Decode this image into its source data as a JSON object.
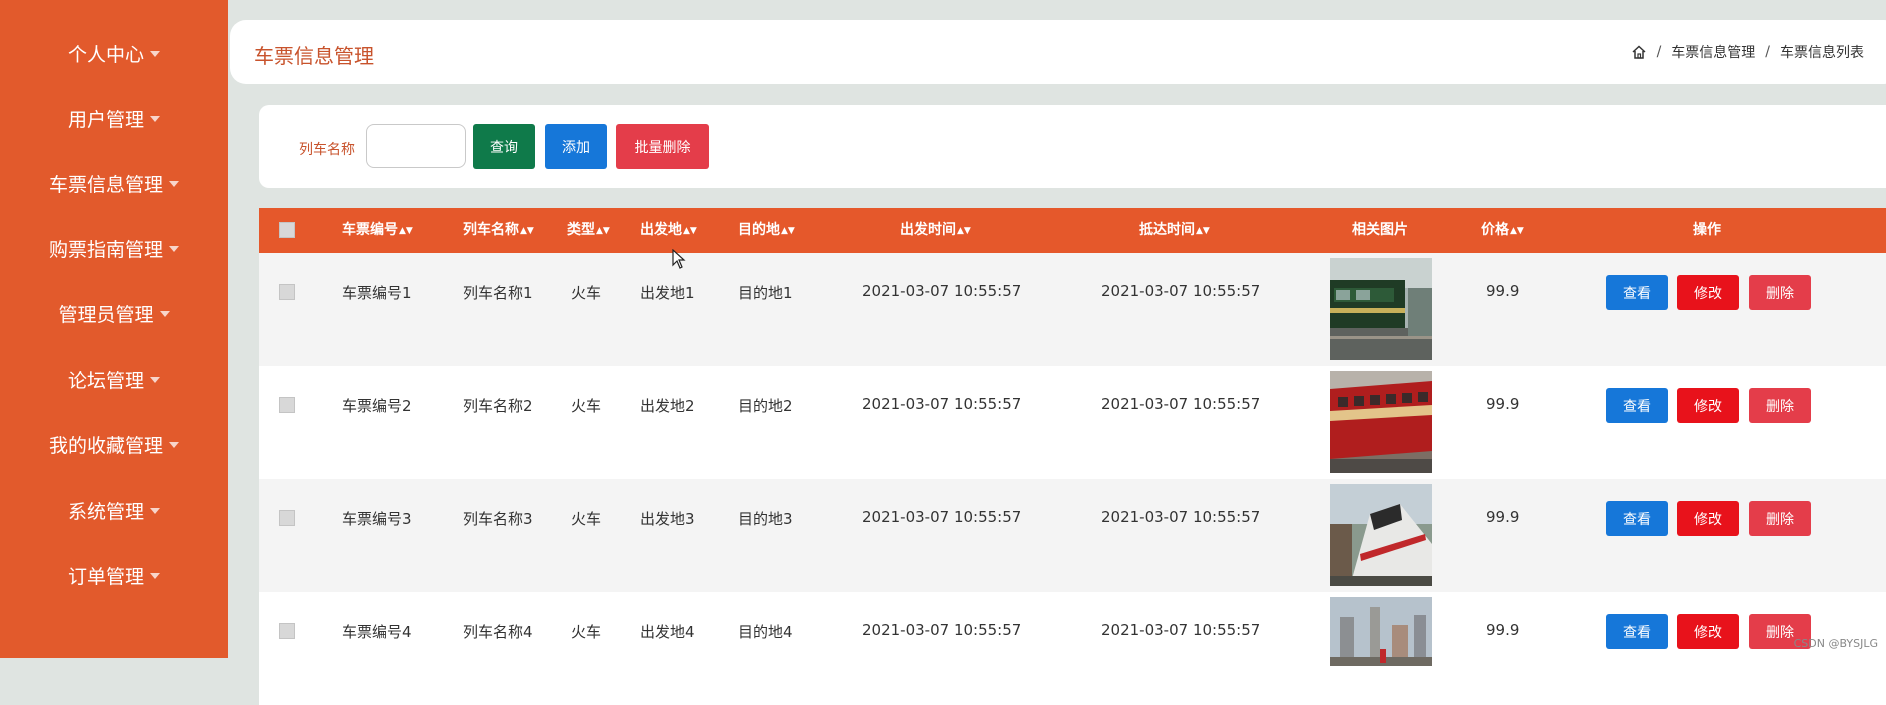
{
  "sidebar": {
    "items": [
      {
        "label": "个人中心"
      },
      {
        "label": "用户管理"
      },
      {
        "label": "车票信息管理"
      },
      {
        "label": "购票指南管理"
      },
      {
        "label": "管理员管理"
      },
      {
        "label": "论坛管理"
      },
      {
        "label": "我的收藏管理"
      },
      {
        "label": "系统管理"
      },
      {
        "label": "订单管理"
      }
    ]
  },
  "header": {
    "title": "车票信息管理",
    "breadcrumb": [
      "车票信息管理",
      "车票信息列表"
    ]
  },
  "search": {
    "label": "列车名称",
    "value": "",
    "query_label": "查询",
    "add_label": "添加",
    "batch_delete_label": "批量删除"
  },
  "table": {
    "columns": {
      "ticket_no": "车票编号",
      "train_name": "列车名称",
      "type": "类型",
      "origin": "出发地",
      "destination": "目的地",
      "depart_time": "出发时间",
      "arrive_time": "抵达时间",
      "image": "相关图片",
      "price": "价格",
      "actions": "操作"
    },
    "rows": [
      {
        "ticket_no": "车票编号1",
        "train_name": "列车名称1",
        "type": "火车",
        "origin": "出发地1",
        "destination": "目的地1",
        "depart_time": "2021-03-07 10:55:57",
        "arrive_time": "2021-03-07 10:55:57",
        "price": "99.9"
      },
      {
        "ticket_no": "车票编号2",
        "train_name": "列车名称2",
        "type": "火车",
        "origin": "出发地2",
        "destination": "目的地2",
        "depart_time": "2021-03-07 10:55:57",
        "arrive_time": "2021-03-07 10:55:57",
        "price": "99.9"
      },
      {
        "ticket_no": "车票编号3",
        "train_name": "列车名称3",
        "type": "火车",
        "origin": "出发地3",
        "destination": "目的地3",
        "depart_time": "2021-03-07 10:55:57",
        "arrive_time": "2021-03-07 10:55:57",
        "price": "99.9"
      },
      {
        "ticket_no": "车票编号4",
        "train_name": "列车名称4",
        "type": "火车",
        "origin": "出发地4",
        "destination": "目的地4",
        "depart_time": "2021-03-07 10:55:57",
        "arrive_time": "2021-03-07 10:55:57",
        "price": "99.9"
      }
    ],
    "actions": {
      "view": "查看",
      "edit": "修改",
      "delete": "删除"
    }
  },
  "watermark": "CSDN @BYSJLG",
  "colors": {
    "sidebar": "#e25a2c",
    "table_header": "#e5582b",
    "query_button": "#0f7a4a",
    "add_button": "#1677d9",
    "batch_delete_button": "#e43d4a",
    "view_button": "#1677d9",
    "edit_button": "#e8121b",
    "delete_button": "#e43d4a"
  },
  "icons": {
    "home": "home-icon",
    "sort": "sort-icon",
    "caret": "chevron-down-icon"
  }
}
